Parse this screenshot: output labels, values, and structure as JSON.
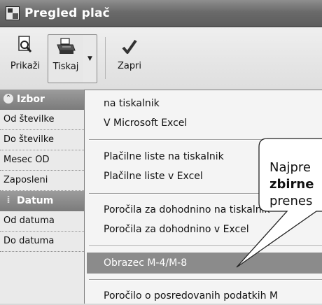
{
  "window": {
    "title": "Pregled plač"
  },
  "toolbar": {
    "preview_label": "Prikaži",
    "print_label": "Tiskaj",
    "close_label": "Zapri"
  },
  "left_panel": {
    "group1_title": "Izbor",
    "rows1": [
      "Od številke",
      "Do številke",
      "Mesec OD",
      "Zaposleni"
    ],
    "group2_title": "Datum",
    "rows2": [
      "Od datuma",
      "Do datuma"
    ]
  },
  "print_menu": {
    "items": [
      "na tiskalnik",
      "V Microsoft Excel",
      "Plačilne liste na tiskalnik",
      "Plačilne liste v Excel",
      "Poročila za dohodnino na tiskalnik",
      "Poročila za dohodnino v Excel",
      "Obrazec M-4/M-8",
      "Poročilo o posredovanih podatkih M"
    ],
    "highlighted_item": "Obrazec M-4/M-8"
  },
  "callout": {
    "line1": "Najpre",
    "line2": "zbirne",
    "line3": "prenes"
  },
  "colors": {
    "titlebar": "#6a6a6a",
    "menu_highlight": "#8b8b8b",
    "group_header": "#8a8a8a"
  }
}
